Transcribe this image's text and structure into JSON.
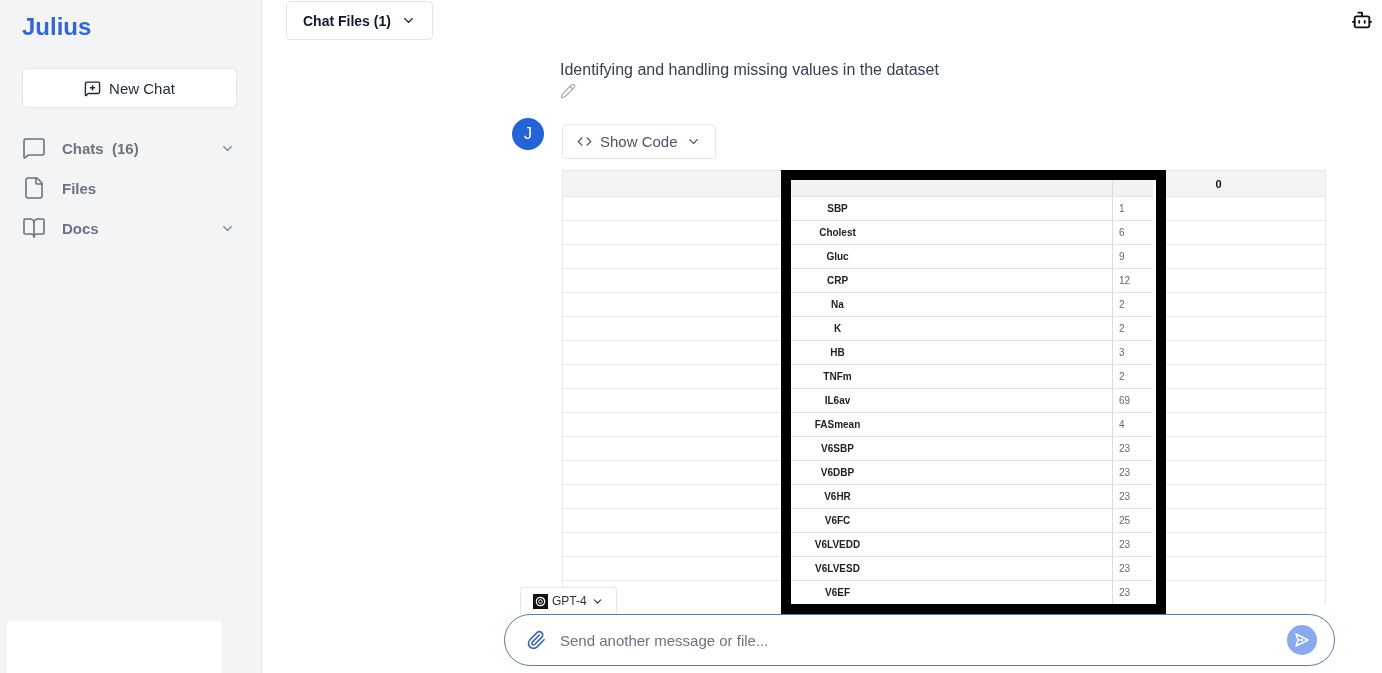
{
  "sidebar": {
    "logo": "Julius",
    "new_chat_button": "New Chat",
    "items": [
      {
        "kind": "chats",
        "label": "Chats",
        "count": "(16)",
        "expandable": true
      },
      {
        "kind": "files",
        "label": "Files",
        "expandable": false
      },
      {
        "kind": "docs",
        "label": "Docs",
        "expandable": true
      }
    ]
  },
  "top_bar": {
    "chat_files_button": "Chat Files (1)"
  },
  "conversation": {
    "user_message": "Identifying and handling missing values in the dataset",
    "assistant": {
      "avatar": "J",
      "show_code_button": "Show Code",
      "table": {
        "columns": [
          "0"
        ],
        "inset_rows": [
          {
            "name": "SBP",
            "value": "1"
          },
          {
            "name": "Cholest",
            "value": "6"
          },
          {
            "name": "Gluc",
            "value": "9"
          },
          {
            "name": "CRP",
            "value": "12"
          },
          {
            "name": "Na",
            "value": "2"
          },
          {
            "name": "K",
            "value": "2"
          },
          {
            "name": "HB",
            "value": "3"
          },
          {
            "name": "TNFm",
            "value": "2"
          },
          {
            "name": "IL6av",
            "value": "69"
          },
          {
            "name": "FASmean",
            "value": "4"
          },
          {
            "name": "V6SBP",
            "value": "23"
          },
          {
            "name": "V6DBP",
            "value": "23"
          },
          {
            "name": "V6HR",
            "value": "23"
          },
          {
            "name": "V6FC",
            "value": "25"
          },
          {
            "name": "V6LVEDD",
            "value": "23"
          },
          {
            "name": "V6LVESD",
            "value": "23"
          },
          {
            "name": "V6EF",
            "value": "23"
          }
        ]
      }
    }
  },
  "composer": {
    "model": "GPT-4",
    "placeholder": "Send another message or file..."
  }
}
